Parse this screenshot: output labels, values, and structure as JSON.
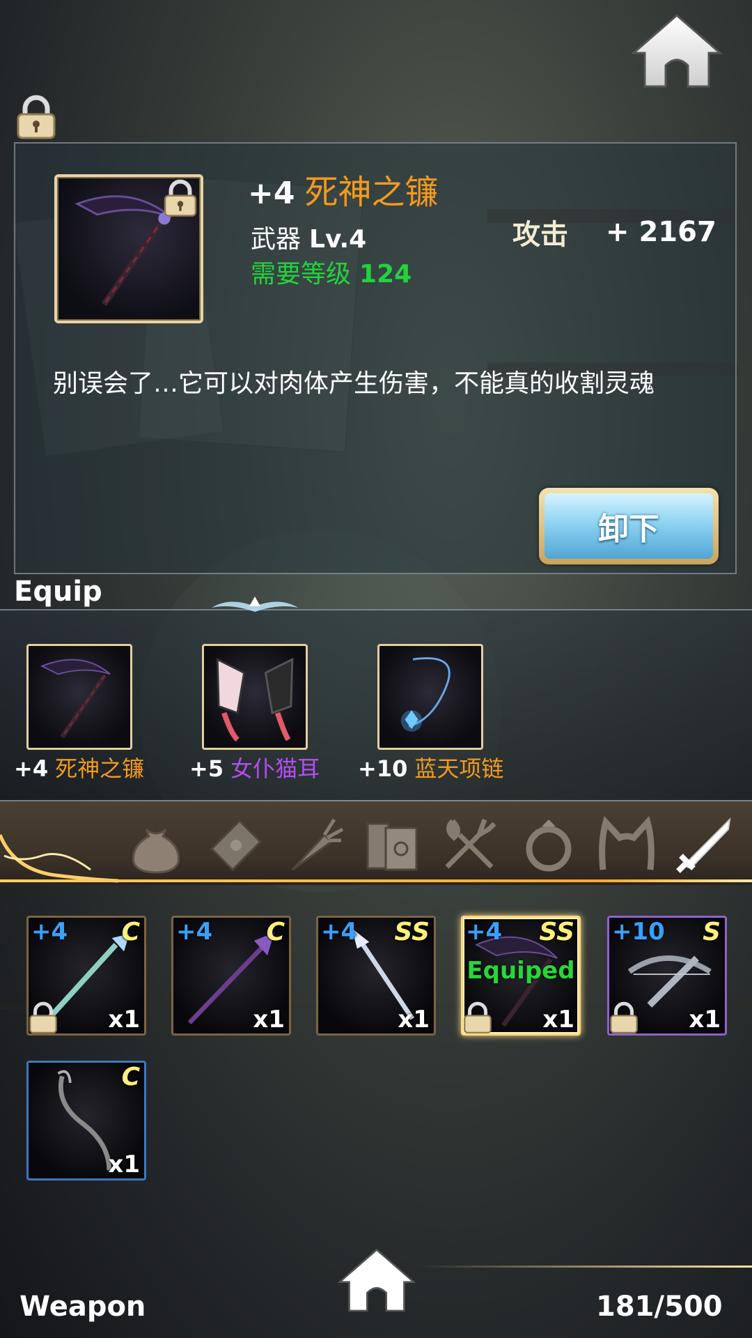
{
  "header": {
    "home_icon": "home-icon",
    "lock_icon": "lock-icon"
  },
  "item_detail": {
    "enhance": "+4",
    "name": "死神之镰",
    "type": "武器",
    "level": "Lv.4",
    "required_label": "需要等级",
    "required_value": "124",
    "stat_label": "攻击",
    "stat_value": "+ 2167",
    "description": "别误会了…它可以对肉体产生伤害，不能真的收割灵魂",
    "unequip_label": "卸下",
    "colors": {
      "name": "#f39a1e",
      "required": "#21d43b"
    }
  },
  "equip": {
    "label": "Equip",
    "slots": [
      {
        "enhance": "+4",
        "name": "死神之镰",
        "color": "#f39a1e"
      },
      {
        "enhance": "+5",
        "name": "女仆猫耳",
        "color": "#b44df0"
      },
      {
        "enhance": "+10",
        "name": "蓝天项链",
        "color": "#f39a1e"
      }
    ]
  },
  "tabs": [
    {
      "icon": "bag-icon"
    },
    {
      "icon": "letter-icon"
    },
    {
      "icon": "carrot-icon"
    },
    {
      "icon": "book-icon"
    },
    {
      "icon": "utensils-icon"
    },
    {
      "icon": "ring-icon"
    },
    {
      "icon": "cat-ears-icon"
    },
    {
      "icon": "sword-icon",
      "active": true
    }
  ],
  "inventory": {
    "items": [
      {
        "enhance": "+4",
        "grade": "C",
        "qty": "x1",
        "locked": true,
        "frame": "bronze"
      },
      {
        "enhance": "+4",
        "grade": "C",
        "qty": "x1",
        "locked": false,
        "frame": "bronze"
      },
      {
        "enhance": "+4",
        "grade": "SS",
        "qty": "x1",
        "locked": false,
        "frame": "bronze"
      },
      {
        "enhance": "+4",
        "grade": "SS",
        "qty": "x1",
        "locked": true,
        "frame": "gold",
        "equipped": "Equiped"
      },
      {
        "enhance": "+10",
        "grade": "S",
        "qty": "x1",
        "locked": true,
        "frame": "purple"
      },
      {
        "enhance": "",
        "grade": "C",
        "qty": "x1",
        "locked": false,
        "frame": "blue"
      }
    ]
  },
  "footer": {
    "category": "Weapon",
    "count": "181/500"
  }
}
